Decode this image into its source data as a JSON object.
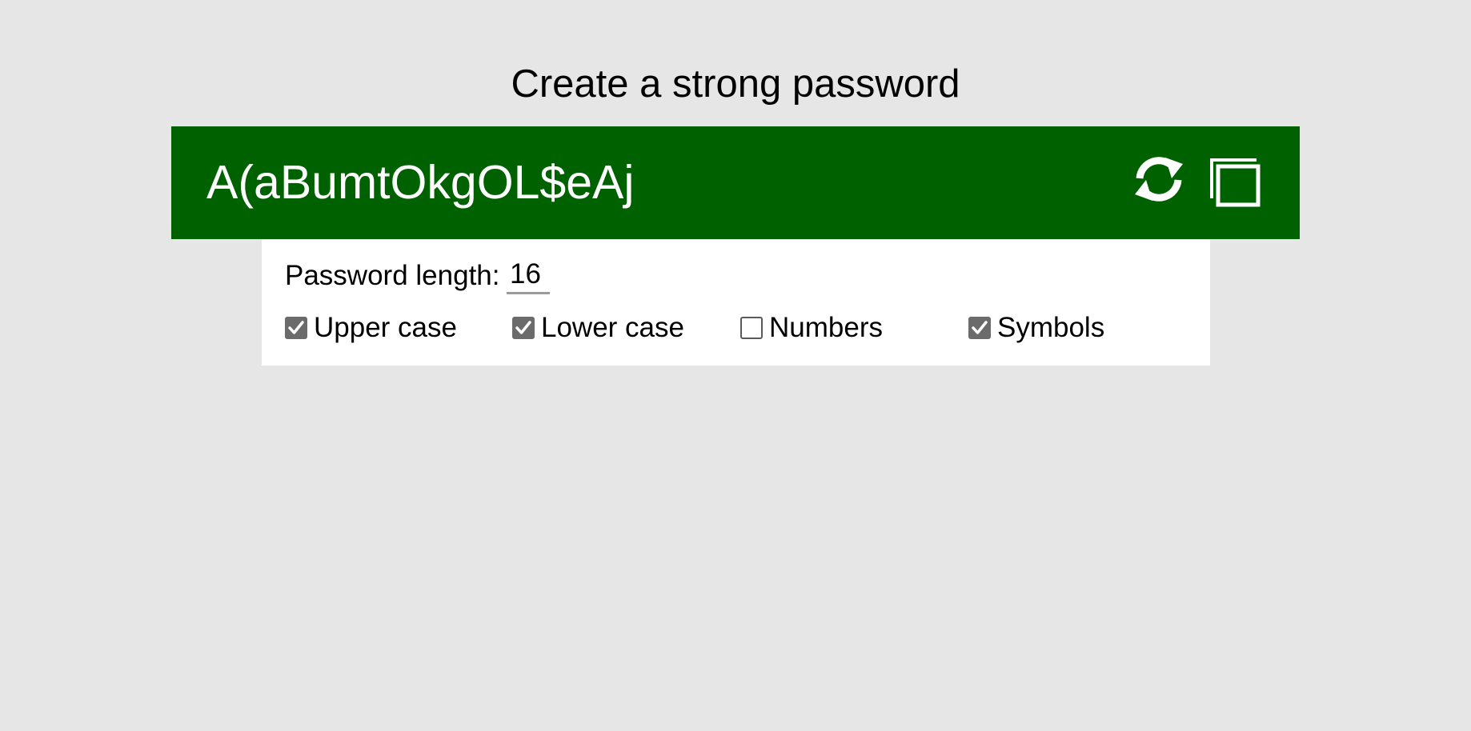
{
  "page": {
    "title": "Create a strong password"
  },
  "password": {
    "value": "A(aBumtOkgOL$eAj",
    "refresh_icon": "refresh-icon",
    "copy_icon": "copy-icon",
    "accent_color": "#006100"
  },
  "options": {
    "length_label": "Password length:",
    "length_value": "16",
    "checkboxes": [
      {
        "label": "Upper case",
        "checked": true
      },
      {
        "label": "Lower case",
        "checked": true
      },
      {
        "label": "Numbers",
        "checked": false
      },
      {
        "label": "Symbols",
        "checked": true
      }
    ]
  }
}
